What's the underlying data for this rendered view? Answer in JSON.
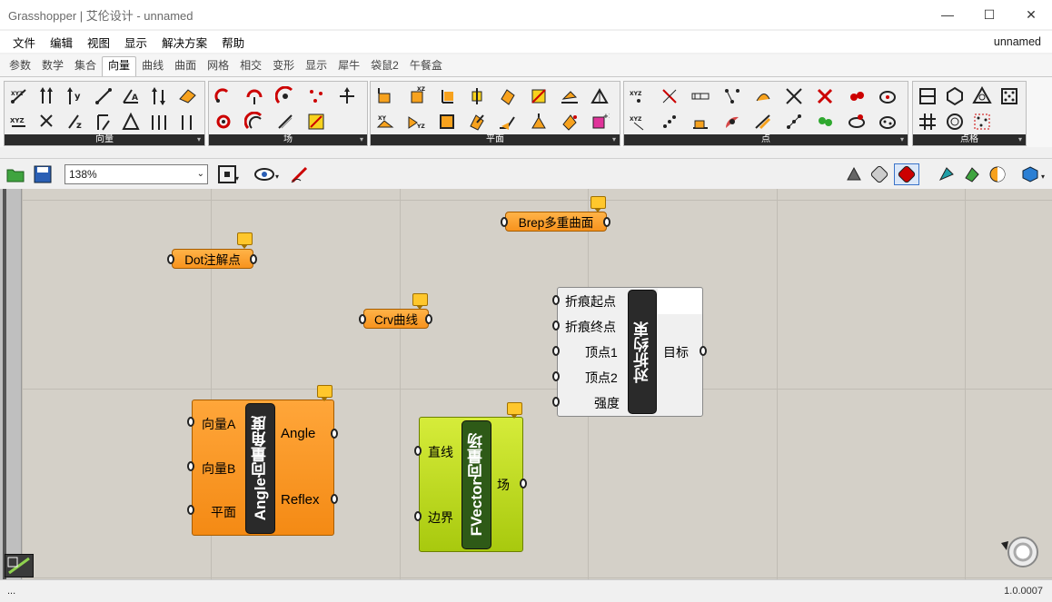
{
  "window": {
    "title": "Grasshopper | 艾伦设计 - unnamed",
    "minimize": "—",
    "maximize": "☐",
    "close": "✕"
  },
  "menu": {
    "items": [
      "文件",
      "编辑",
      "视图",
      "显示",
      "解决方案",
      "帮助"
    ],
    "document_name": "unnamed"
  },
  "tabs": [
    "参数",
    "数学",
    "集合",
    "向量",
    "曲线",
    "曲面",
    "网格",
    "相交",
    "变形",
    "显示",
    "犀牛",
    "袋鼠2",
    "午餐盒"
  ],
  "active_tab": "向量",
  "ribbon": {
    "panels": [
      {
        "label": "向量"
      },
      {
        "label": "场"
      },
      {
        "label": "平面"
      },
      {
        "label": "点"
      },
      {
        "label": "点格"
      }
    ]
  },
  "toolbar": {
    "zoom": "138%"
  },
  "canvas": {
    "params": [
      {
        "label": "Dot注解点"
      },
      {
        "label": "Crv曲线"
      },
      {
        "label": "Brep多重曲面"
      }
    ],
    "angle_component": {
      "nickname": "Angle向量角度",
      "inputs": [
        "向量A",
        "向量B",
        "平面"
      ],
      "outputs": [
        "Angle",
        "Reflex"
      ]
    },
    "fvector_component": {
      "nickname": "FVector向量场",
      "inputs": [
        "直线",
        "边界"
      ],
      "outputs": [
        "场"
      ]
    },
    "fold_component": {
      "nickname": "对折约束",
      "inputs": [
        "折痕起点",
        "折痕终点",
        "顶点1",
        "顶点2",
        "强度"
      ],
      "outputs": [
        "目标"
      ]
    }
  },
  "status": {
    "left": "...",
    "version": "1.0.0007"
  },
  "colors": {
    "canvas": "#d4d0c8",
    "param_orange": "#f7931e",
    "vector_green": "#b5d61e",
    "component_white": "#f2f2f2"
  }
}
